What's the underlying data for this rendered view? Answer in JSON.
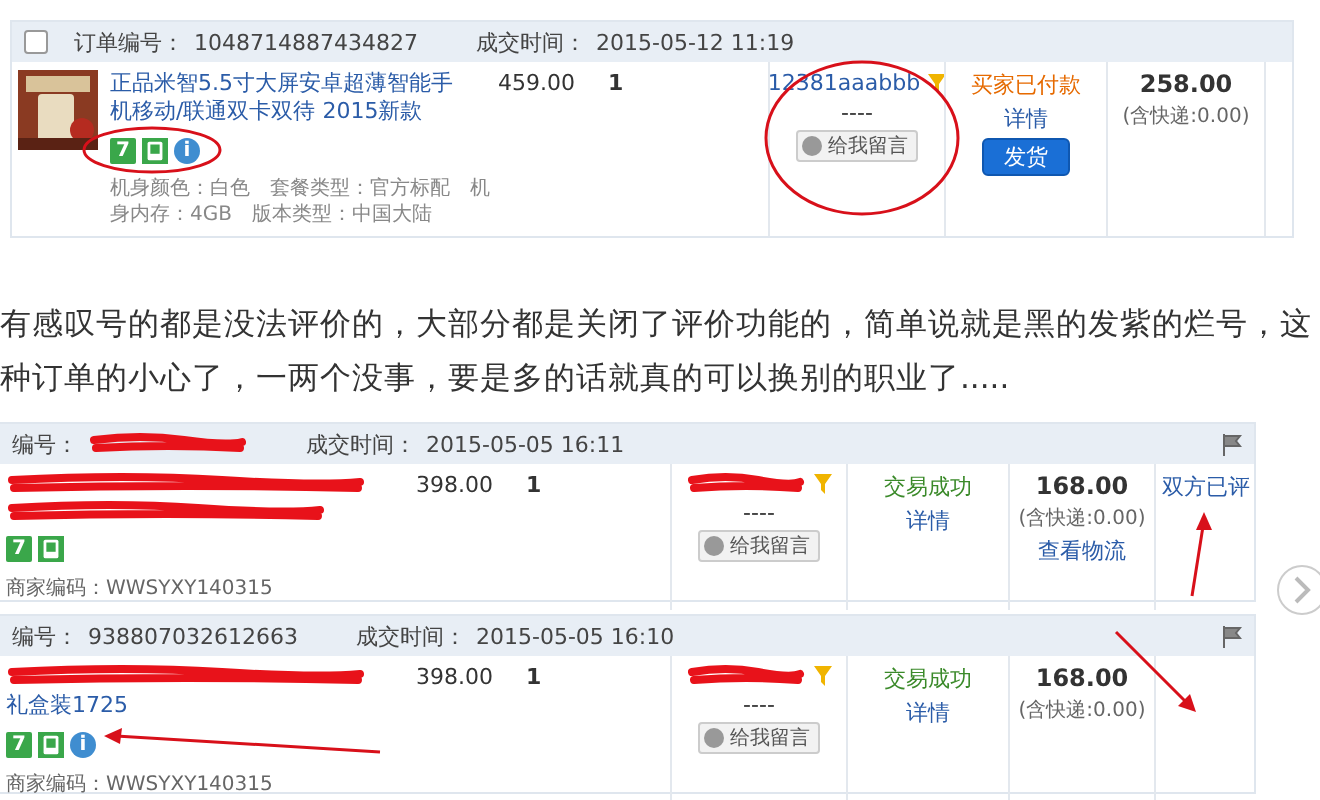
{
  "orders": [
    {
      "header": {
        "checkbox": {
          "checked": false
        },
        "order_no_label": "订单编号：",
        "order_no": "1048714887434827",
        "time_label": "成交时间：",
        "time": "2015-05-12 11:19"
      },
      "product": {
        "thumbnail": true,
        "title": "正品米智5.5寸大屏安卓超薄智能手机移动/联通双卡双待 2015新款",
        "badges": [
          {
            "kind": "seven",
            "text": "7"
          },
          {
            "kind": "guarantee"
          },
          {
            "kind": "info",
            "text": "i"
          }
        ],
        "props": "机身颜色：白色　套餐类型：官方标配　机身内存：4GB　版本类型：中国大陆"
      },
      "price": "459.00",
      "qty": "1",
      "buyer": {
        "name": "12381aaabbb",
        "dash": "----",
        "message_button": "给我留言"
      },
      "status": {
        "kind": "paid",
        "text": "买家已付款",
        "detail": "详情",
        "action": "发货"
      },
      "total": {
        "amount": "258.00",
        "shipping": "(含快递:0.00)"
      }
    },
    {
      "header": {
        "order_no_label": "编号：",
        "order_no_redacted": true,
        "time_label": "成交时间：",
        "time": "2015-05-05 16:11",
        "flag": true
      },
      "product": {
        "title_redacted": true,
        "badges": [
          {
            "kind": "seven",
            "text": "7"
          },
          {
            "kind": "guarantee"
          }
        ],
        "merchant_code": "商家编码：WWSYXY140315"
      },
      "price": "398.00",
      "qty": "1",
      "buyer": {
        "redacted": true,
        "dash": "----",
        "message_button": "给我留言"
      },
      "status": {
        "kind": "success",
        "text": "交易成功",
        "detail": "详情"
      },
      "total": {
        "amount": "168.00",
        "shipping": "(含快递:0.00)",
        "logistics": "查看物流"
      },
      "evaluation": "双方已评"
    },
    {
      "header": {
        "order_no_label": "编号：",
        "order_no": "938807032612663",
        "time_label": "成交时间：",
        "time": "2015-05-05 16:10",
        "flag": true
      },
      "product": {
        "title_redacted": true,
        "title_visible": "礼盒装1725",
        "badges": [
          {
            "kind": "seven",
            "text": "7"
          },
          {
            "kind": "guarantee"
          },
          {
            "kind": "info",
            "text": "i"
          }
        ],
        "merchant_code": "商家编码：WWSYXY140315"
      },
      "price": "398.00",
      "qty": "1",
      "buyer": {
        "redacted": true,
        "dash": "----",
        "message_button": "给我留言"
      },
      "status": {
        "kind": "success",
        "text": "交易成功",
        "detail": "详情"
      },
      "total": {
        "amount": "168.00",
        "shipping": "(含快递:0.00)"
      }
    }
  ],
  "comment": "有感叹号的都是没法评价的，大部分都是关闭了评价功能的，简单说就是黑的发紫的烂号，这种订单的小心了，一两个没事，要是多的话就真的可以换别的职业了....."
}
